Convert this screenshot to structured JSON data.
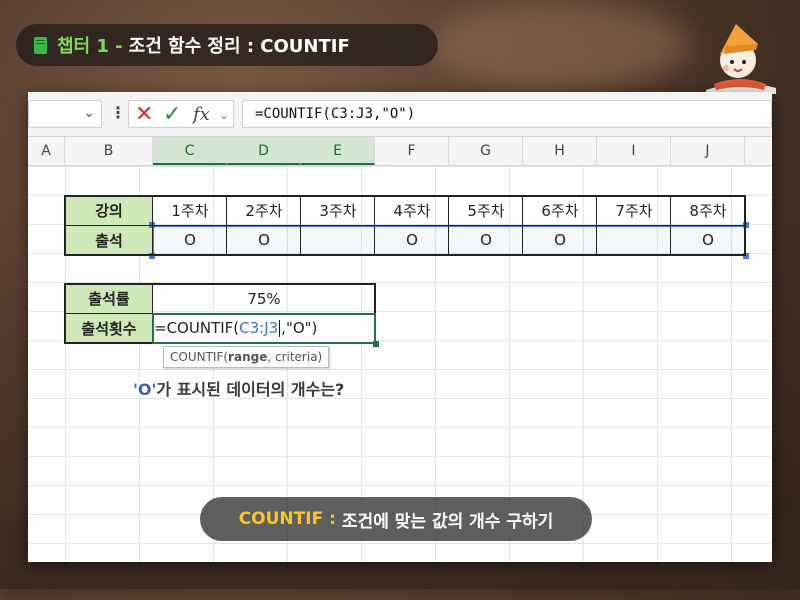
{
  "title": {
    "chapter": "챕터 1 -",
    "text": "조건 함수 정리 : COUNTIF"
  },
  "formula_bar": {
    "formula": "=COUNTIF(C3:J3,\"O\")",
    "fx": "fx"
  },
  "columns": [
    "A",
    "B",
    "C",
    "D",
    "E",
    "F",
    "G",
    "H",
    "I",
    "J"
  ],
  "table1": {
    "row1_label": "강의",
    "weeks": [
      "1주차",
      "2주차",
      "3주차",
      "4주차",
      "5주차",
      "6주차",
      "7주차",
      "8주차"
    ],
    "row2_label": "출석",
    "attendance": [
      "O",
      "O",
      "",
      "O",
      "O",
      "O",
      "",
      "O"
    ]
  },
  "table2": {
    "rate_label": "출석률",
    "rate_value": "75%",
    "count_label": "출석횟수",
    "cell_prefix": "=COUNTIF(",
    "cell_ref": "C3:J3",
    "cell_suffix": ",\"O\")"
  },
  "tooltip": {
    "fn": "COUNTIF(",
    "arg1": "range",
    "rest": ", criteria)"
  },
  "annotation": {
    "highlight": "'O'",
    "text": "가 표시된 데이터의 개수는?"
  },
  "subtitle": {
    "key": "COUNTIF :",
    "text": "조건에 맞는 값의 개수 구하기"
  },
  "colors": {
    "accent_green": "#217346",
    "header_fill": "#cfe8b8",
    "ref_blue": "#3b73c9",
    "subtitle_yellow": "#f7c528"
  }
}
